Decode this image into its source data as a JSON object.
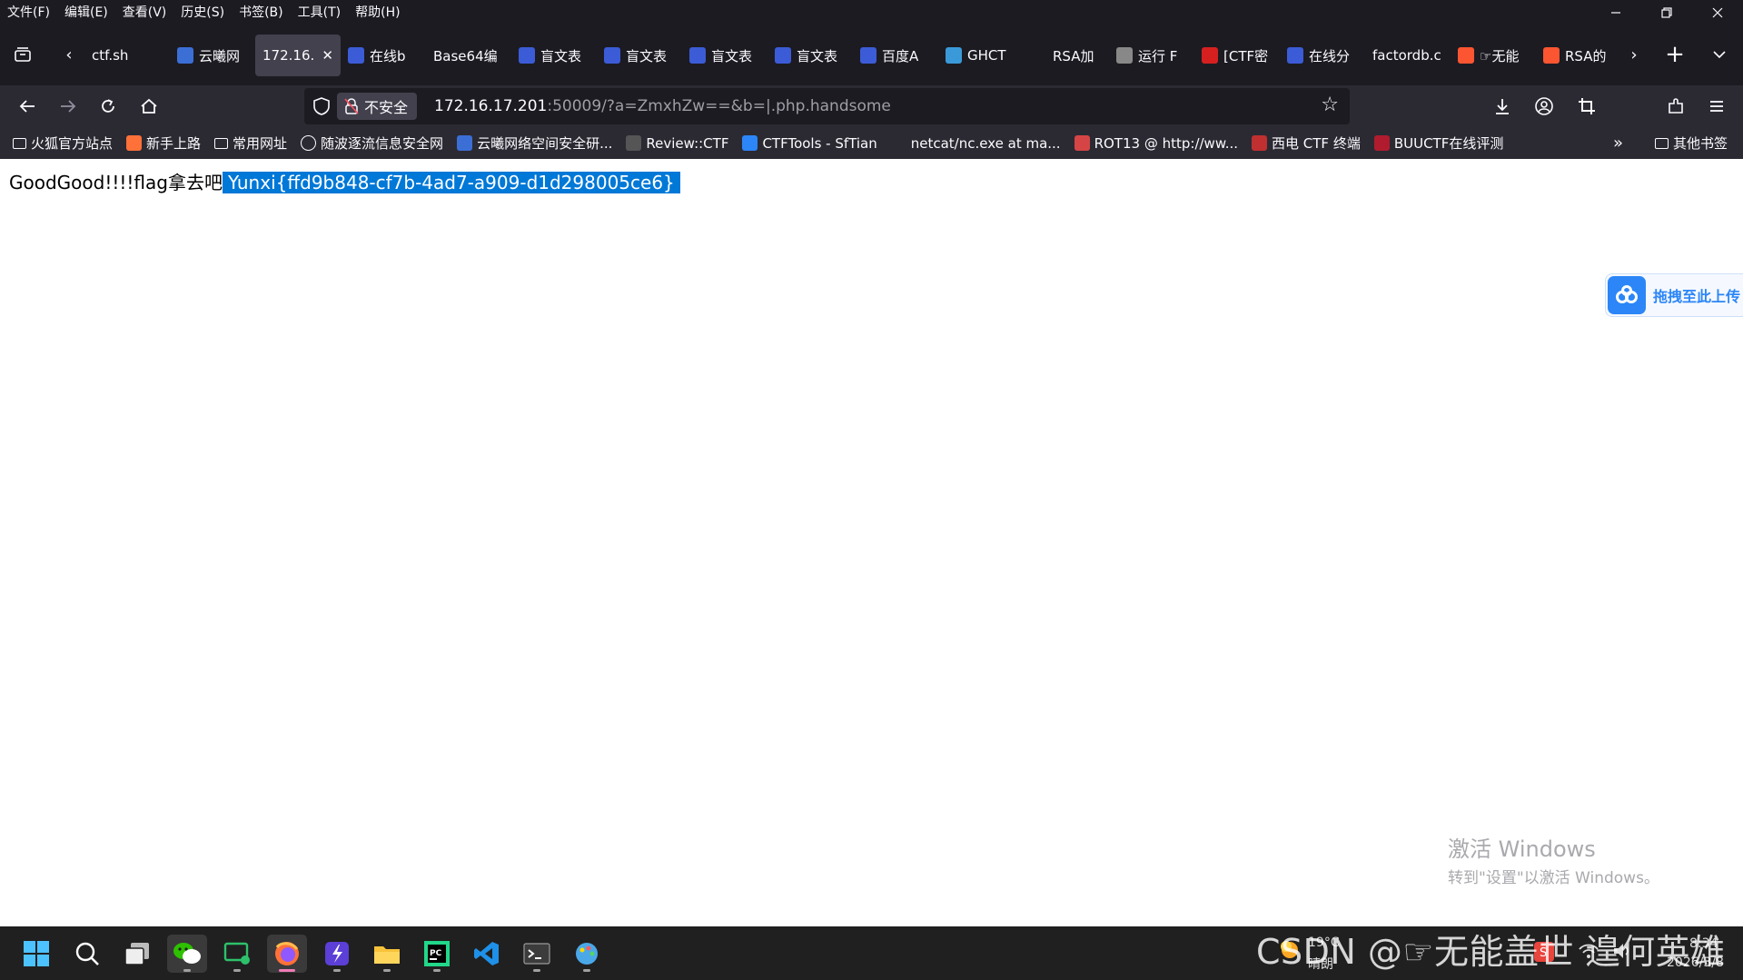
{
  "menubar": {
    "items": [
      "文件(F)",
      "编辑(E)",
      "查看(V)",
      "历史(S)",
      "书签(B)",
      "工具(T)",
      "帮助(H)"
    ]
  },
  "tabs": [
    {
      "label": "ctf.sh",
      "icon": "none",
      "color": ""
    },
    {
      "label": "云曦网",
      "icon": "site-favicon",
      "color": "#3b6fd6"
    },
    {
      "label": "172.16.",
      "icon": "none",
      "color": "",
      "active": true
    },
    {
      "label": "在线b",
      "icon": "baidu-icon",
      "color": "#3b5cd6"
    },
    {
      "label": "Base64编",
      "icon": "none",
      "color": ""
    },
    {
      "label": "盲文表",
      "icon": "baidu-icon",
      "color": "#3b5cd6"
    },
    {
      "label": "盲文表",
      "icon": "baidu-icon",
      "color": "#3b5cd6"
    },
    {
      "label": "盲文表",
      "icon": "baidu-icon",
      "color": "#3b5cd6"
    },
    {
      "label": "盲文表",
      "icon": "baidu-icon",
      "color": "#3b5cd6"
    },
    {
      "label": "百度A",
      "icon": "baidu-icon",
      "color": "#3b5cd6"
    },
    {
      "label": "GHCT",
      "icon": "site-favicon",
      "color": "#3a9ad9"
    },
    {
      "label": "RSA加",
      "icon": "k-icon",
      "color": "#1c1b22"
    },
    {
      "label": "运行 F",
      "icon": "site-favicon",
      "color": "#888888"
    },
    {
      "label": "[CTF密",
      "icon": "51-icon",
      "color": "#d62020"
    },
    {
      "label": "在线分",
      "icon": "baidu-icon",
      "color": "#3b5cd6"
    },
    {
      "label": "factordb.c",
      "icon": "none",
      "color": ""
    },
    {
      "label": "☞无能",
      "icon": "csdn-icon",
      "color": "#fc5531"
    },
    {
      "label": "RSA的",
      "icon": "csdn-icon",
      "color": "#fc5531"
    }
  ],
  "navbar": {
    "security_label": "不安全",
    "url_host": "172.16.17.201",
    "url_rest": ":50009/?a=ZmxhZw==&b=|.php.handsome"
  },
  "bookmarks": {
    "items": [
      {
        "label": "火狐官方站点",
        "icon": "folder-icon",
        "color": ""
      },
      {
        "label": "新手上路",
        "icon": "firefox-icon",
        "color": "#ff7139"
      },
      {
        "label": "常用网址",
        "icon": "folder-icon",
        "color": ""
      },
      {
        "label": "随波逐流信息安全网",
        "icon": "globe-icon",
        "color": ""
      },
      {
        "label": "云曦网络空间安全研...",
        "icon": "site-favicon",
        "color": "#3b6fd6"
      },
      {
        "label": "Review::CTF",
        "icon": "site-favicon",
        "color": "#555555"
      },
      {
        "label": "CTFTools - SfTian",
        "icon": "site-favicon",
        "color": "#2c86f7"
      },
      {
        "label": "netcat/nc.exe at ma...",
        "icon": "github-icon",
        "color": "#2b2a33"
      },
      {
        "label": "ROT13 @ http://ww...",
        "icon": "site-favicon",
        "color": "#d64545"
      },
      {
        "label": "西电 CTF 终端",
        "icon": "site-favicon",
        "color": "#c03030"
      },
      {
        "label": "BUUCTF在线评测",
        "icon": "site-favicon",
        "color": "#b01c2e"
      }
    ],
    "other_label": "其他书签"
  },
  "page": {
    "text": "GoodGood!!!!flag拿去吧",
    "flag": "Yunxi{ffd9b848-cf7b-4ad7-a909-d1d298005ce6}"
  },
  "upload_widget": {
    "label": "拖拽至此上传"
  },
  "activation": {
    "title": "激活 Windows",
    "subtitle": "转到\"设置\"以激活 Windows。"
  },
  "taskbar": {
    "apps": [
      "start-icon",
      "search-icon",
      "task-view-icon",
      "wechat-icon",
      "terminal-app-icon",
      "firefox-icon",
      "app-icon",
      "file-explorer-icon",
      "pycharm-icon",
      "vscode-icon",
      "terminal-icon",
      "paint-icon"
    ],
    "weather_temp": "19°C",
    "weather_desc": "晴朗",
    "time": "8:34",
    "date": "2026/3/8"
  },
  "watermark": "CSDN @☞无能盖世 遑何英雄"
}
